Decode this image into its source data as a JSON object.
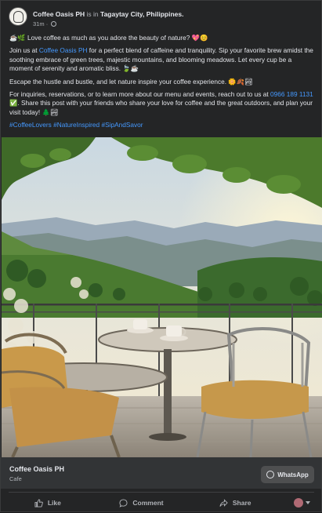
{
  "post": {
    "author": "Coffee Oasis PH",
    "location_prefix": "is in",
    "location": "Tagaytay City, Philippines.",
    "time": "31m",
    "dot": "·",
    "paragraphs": {
      "p1": "☕🌿 Love coffee as much as you adore the beauty of nature? 💖😊",
      "p2_before": "Join us at ",
      "p2_link": "Coffee Oasis PH",
      "p2_after": " for a perfect blend of caffeine and tranquility. Sip your favorite brew amidst the soothing embrace of green trees, majestic mountains, and blooming meadows. Let every cup be a moment of serenity and aromatic bliss. 🍃☕",
      "p3": "Escape the hustle and bustle, and let nature inspire your coffee experience. 🌼🍂🏞",
      "p4_before": "For inquiries, reservations, or to learn more about our menu and events, reach out to us at ",
      "p4_phone": "0966 189 1131",
      "p4_after": " ✅. Share this post with your friends who share your love for coffee and the great outdoors, and plan your visit today! 🌲🏞",
      "hashtags": "#CoffeeLovers #NatureInspired #SipAndSavor"
    }
  },
  "page_card": {
    "name": "Coffee Oasis PH",
    "category": "Cafe",
    "whatsapp_label": "WhatsApp"
  },
  "actions": {
    "like": "Like",
    "comment": "Comment",
    "share": "Share"
  },
  "colors": {
    "link": "#4599ff",
    "background": "#242526"
  },
  "icons": [
    "globe-icon",
    "whatsapp-icon",
    "like-icon",
    "comment-icon",
    "share-icon",
    "chevron-down-icon"
  ]
}
